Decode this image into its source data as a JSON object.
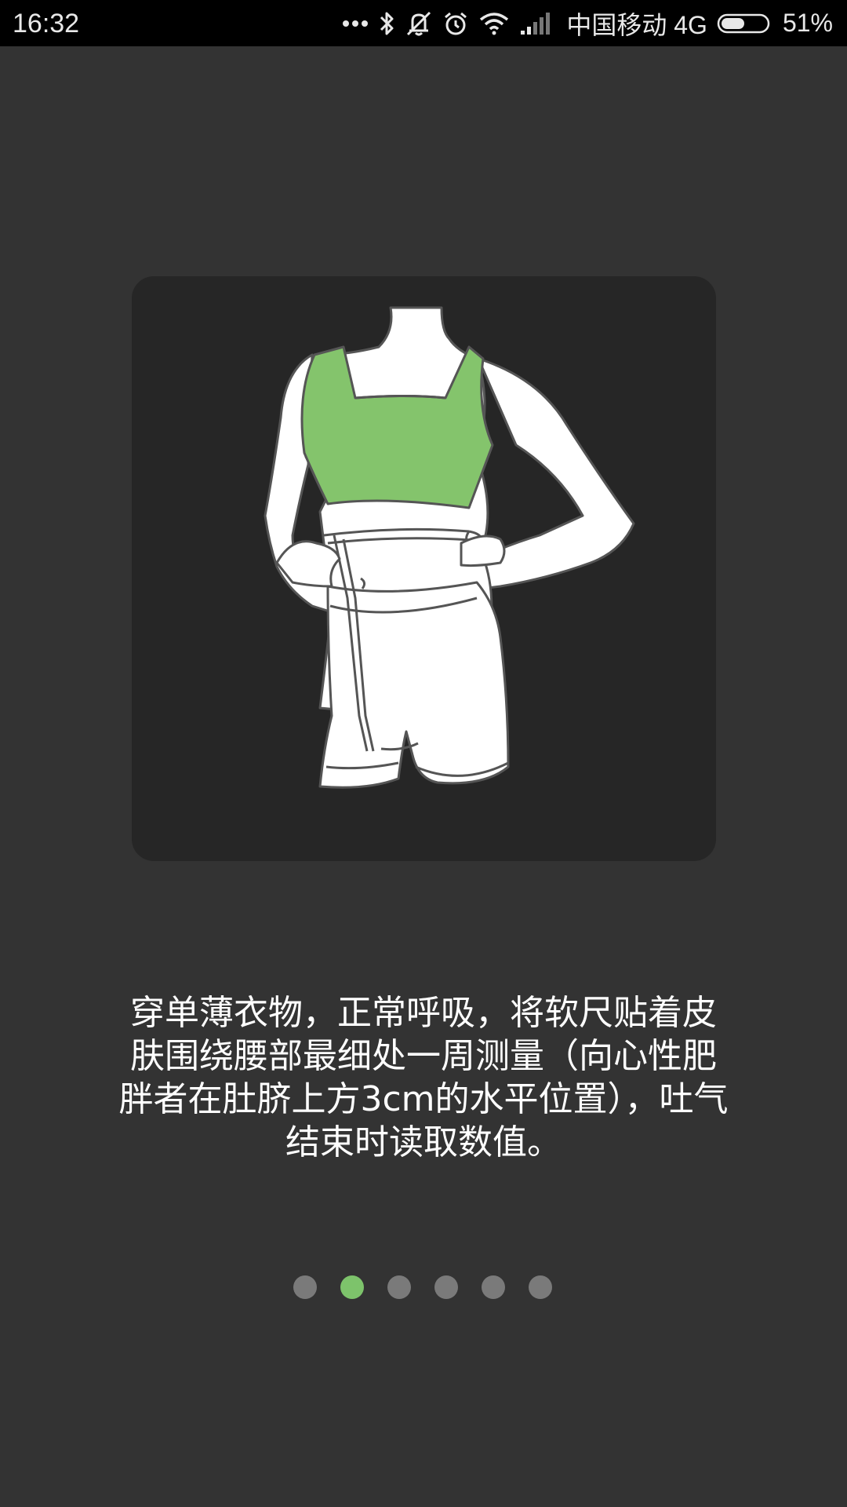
{
  "status_bar": {
    "time": "16:32",
    "icons": [
      "more-dots-icon",
      "bluetooth-icon",
      "vibrate-mute-icon",
      "alarm-icon",
      "wifi-icon",
      "signal-icon"
    ],
    "carrier": "中国移动 4G",
    "battery_percent": "51%",
    "battery_level": 0.51
  },
  "illustration": {
    "subject": "waist-measurement-figure",
    "accent_color": "#84c46c"
  },
  "instruction": {
    "text": "穿单薄衣物，正常呼吸，将软尺贴着皮肤围绕腰部最细处一周测量（向心性肥胖者在肚脐上方3cm的水平位置），吐气结束时读取数值。"
  },
  "pager": {
    "total": 6,
    "active_index": 1,
    "active_color": "#7dc36b",
    "inactive_color": "#7a7a7a"
  }
}
